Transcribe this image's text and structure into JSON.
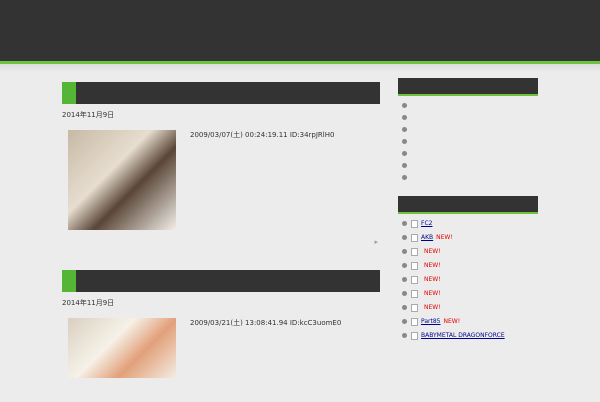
{
  "header": {
    "site_title": "",
    "tagline": "",
    "note": ""
  },
  "posts": [
    {
      "title": "",
      "date": "2014年11月9日",
      "category": "",
      "excerpt": "2009/03/07(土) 00:24:19.11 ID:34rpJRlH0",
      "read_more": ""
    },
    {
      "title": "",
      "date": "2014年11月9日",
      "category": "",
      "excerpt": "2009/03/21(土) 13:08:41.94 ID:kcC3uomE0",
      "read_more": ""
    }
  ],
  "sidebar": {
    "categories": {
      "title": "",
      "items": [
        "",
        "",
        "",
        "",
        "",
        "",
        ""
      ]
    },
    "feeds": {
      "title": "",
      "new_label": "NEW!",
      "items": [
        {
          "text": "FC2"
        },
        {
          "text": "AKB"
        },
        {
          "text": ""
        },
        {
          "text": ""
        },
        {
          "text": ""
        },
        {
          "text": ""
        },
        {
          "text": ""
        },
        {
          "text": "Part85"
        },
        {
          "text": "BABYMETAL DRAGONFORCE"
        }
      ]
    }
  },
  "colors": {
    "accent": "#6fc23c",
    "header_bg": "#333333",
    "badge": "#e60000"
  }
}
